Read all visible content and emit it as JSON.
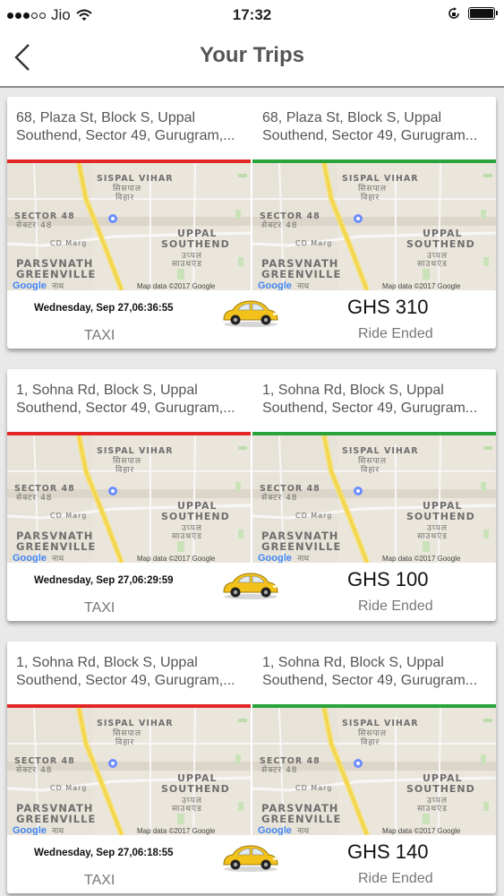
{
  "status_bar": {
    "carrier": "Jio",
    "time": "17:32"
  },
  "header": {
    "title": "Your Trips"
  },
  "map_labels": {
    "sispal": "SISPAL VIHAR",
    "sispal_hi": "सिसपाल",
    "sispal_hi2": "विहार",
    "sector": "SECTOR 48",
    "sector_hi": "सेक्टर 48",
    "cd_marg": "CD Marg",
    "uppal1": "UPPAL",
    "uppal2": "SOUTHEND",
    "uppal_hi1": "उप्पल",
    "uppal_hi2": "साउथएंड",
    "parsvnath1": "PARSVNATH",
    "parsvnath2": "GREENVILLE",
    "google": "Google",
    "google_hi": "नाथ",
    "attribution": "Map data ©2017 Google"
  },
  "trips": [
    {
      "pickup_line1": "68, Plaza St, Block S, Uppal",
      "pickup_line2": "Southend, Sector 49, Gurugram,...",
      "drop_line1": "68, Plaza St, Block S, Uppal",
      "drop_line2": "Southend, Sector 49, Gurugram...",
      "datetime": "Wednesday, Sep 27,06:36:55",
      "fare": "GHS 310",
      "vehicle": "TAXI",
      "status": "Ride Ended"
    },
    {
      "pickup_line1": "1, Sohna Rd, Block S, Uppal",
      "pickup_line2": "Southend, Sector 49, Gurugram,...",
      "drop_line1": "1, Sohna Rd, Block S, Uppal",
      "drop_line2": "Southend, Sector 49, Gurugram...",
      "datetime": "Wednesday, Sep 27,06:29:59",
      "fare": "GHS 100",
      "vehicle": "TAXI",
      "status": "Ride Ended"
    },
    {
      "pickup_line1": "1, Sohna Rd, Block S, Uppal",
      "pickup_line2": "Southend, Sector 49, Gurugram,...",
      "drop_line1": "1, Sohna Rd, Block S, Uppal",
      "drop_line2": "Southend, Sector 49, Gurugram...",
      "datetime": "Wednesday, Sep 27,06:18:55",
      "fare": "GHS 140",
      "vehicle": "TAXI",
      "status": "Ride Ended"
    }
  ],
  "colors": {
    "pickup_line": "#e32626",
    "drop_line": "#2aa43a",
    "taxi": "#f2c21b"
  }
}
